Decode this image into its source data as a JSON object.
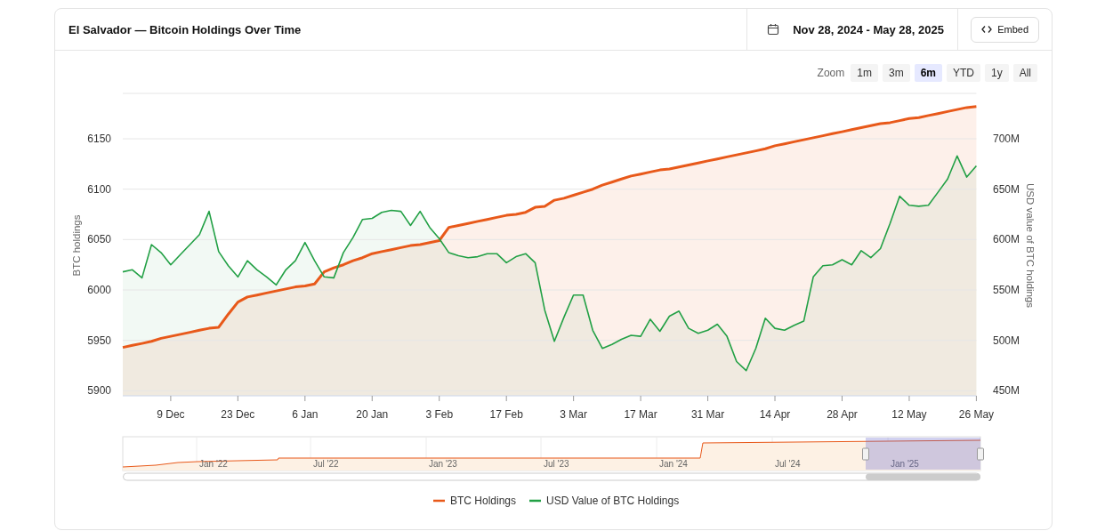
{
  "header": {
    "title": "El Salvador — Bitcoin Holdings Over Time",
    "date_range": "Nov 28, 2024 - May 28, 2025",
    "embed_label": "Embed"
  },
  "zoom": {
    "label": "Zoom",
    "options": [
      {
        "label": "1m",
        "selected": false
      },
      {
        "label": "3m",
        "selected": false
      },
      {
        "label": "6m",
        "selected": true
      },
      {
        "label": "YTD",
        "selected": false
      },
      {
        "label": "1y",
        "selected": false
      },
      {
        "label": "All",
        "selected": false
      }
    ]
  },
  "chart_data": {
    "type": "area",
    "grid": true,
    "legend": true,
    "ylabel": "BTC holdings",
    "y2label": "USD value of BTC holdings",
    "categories": [
      null,
      null,
      null,
      null,
      null,
      "9 Dec",
      null,
      null,
      null,
      null,
      null,
      null,
      "23 Dec",
      null,
      null,
      null,
      null,
      null,
      null,
      "6 Jan",
      null,
      null,
      null,
      null,
      null,
      null,
      "20 Jan",
      null,
      null,
      null,
      null,
      null,
      null,
      "3 Feb",
      null,
      null,
      null,
      null,
      null,
      null,
      "17 Feb",
      null,
      null,
      null,
      null,
      null,
      null,
      "3 Mar",
      null,
      null,
      null,
      null,
      null,
      null,
      "17 Mar",
      null,
      null,
      null,
      null,
      null,
      null,
      "31 Mar",
      null,
      null,
      null,
      null,
      null,
      null,
      "14 Apr",
      null,
      null,
      null,
      null,
      null,
      null,
      "28 Apr",
      null,
      null,
      null,
      null,
      null,
      null,
      "12 May",
      null,
      null,
      null,
      null,
      null,
      null,
      "26 May"
    ],
    "ylim": [
      5895,
      6195
    ],
    "yticks": [
      5900,
      5950,
      6000,
      6050,
      6100,
      6150
    ],
    "y2lim": [
      445,
      745
    ],
    "y2ticks": [
      {
        "value": 450,
        "label": "450M"
      },
      {
        "value": 500,
        "label": "500M"
      },
      {
        "value": 550,
        "label": "550M"
      },
      {
        "value": 600,
        "label": "600M"
      },
      {
        "value": 650,
        "label": "650M"
      },
      {
        "value": 700,
        "label": "700M"
      }
    ],
    "series": [
      {
        "name": "BTC Holdings",
        "color": "#e8591a",
        "values": [
          5943,
          5945,
          5947,
          5949,
          5952,
          5954,
          5956,
          5958,
          5960,
          5962,
          5963,
          5976,
          5988,
          5993,
          5995,
          5997,
          5999,
          6001,
          6003,
          6004,
          6006,
          6018,
          6022,
          6025,
          6029,
          6032,
          6036,
          6038,
          6040,
          6042,
          6044,
          6045,
          6047,
          6049,
          6062,
          6064,
          6066,
          6068,
          6070,
          6072,
          6074,
          6075,
          6077,
          6082,
          6083,
          6089,
          6091,
          6094,
          6097,
          6100,
          6104,
          6107,
          6110,
          6113,
          6115,
          6117,
          6119,
          6120,
          6122,
          6124,
          6126,
          6128,
          6130,
          6132,
          6134,
          6136,
          6138,
          6140,
          6143,
          6145,
          6147,
          6149,
          6151,
          6153,
          6155,
          6157,
          6159,
          6161,
          6163,
          6165,
          6166,
          6168,
          6170,
          6171,
          6173,
          6175,
          6177,
          6179,
          6181,
          6182
        ]
      },
      {
        "name": "USD Value of BTC Holdings",
        "color": "#22a045",
        "axis": "y2",
        "values": [
          568,
          570,
          562,
          595,
          587,
          575,
          585,
          595,
          605,
          628,
          588,
          574,
          563,
          579,
          570,
          563,
          555,
          570,
          579,
          597,
          579,
          563,
          562,
          587,
          602,
          620,
          621,
          627,
          629,
          628,
          614,
          628,
          612,
          601,
          587,
          584,
          582,
          583,
          586,
          586,
          577,
          583,
          586,
          577,
          530,
          499,
          523,
          545,
          545,
          510,
          492,
          496,
          501,
          505,
          504,
          521,
          509,
          524,
          529,
          512,
          507,
          510,
          516,
          504,
          479,
          470,
          492,
          522,
          512,
          510,
          515,
          519,
          563,
          574,
          575,
          580,
          575,
          589,
          582,
          591,
          616,
          643,
          634,
          633,
          634,
          647,
          660,
          683,
          662,
          673
        ]
      }
    ]
  },
  "navigator": {
    "labels": [
      "Jan '22",
      "Jul '22",
      "Jan '23",
      "Jul '23",
      "Jan '24",
      "Jul '24",
      "Jan '25"
    ]
  }
}
